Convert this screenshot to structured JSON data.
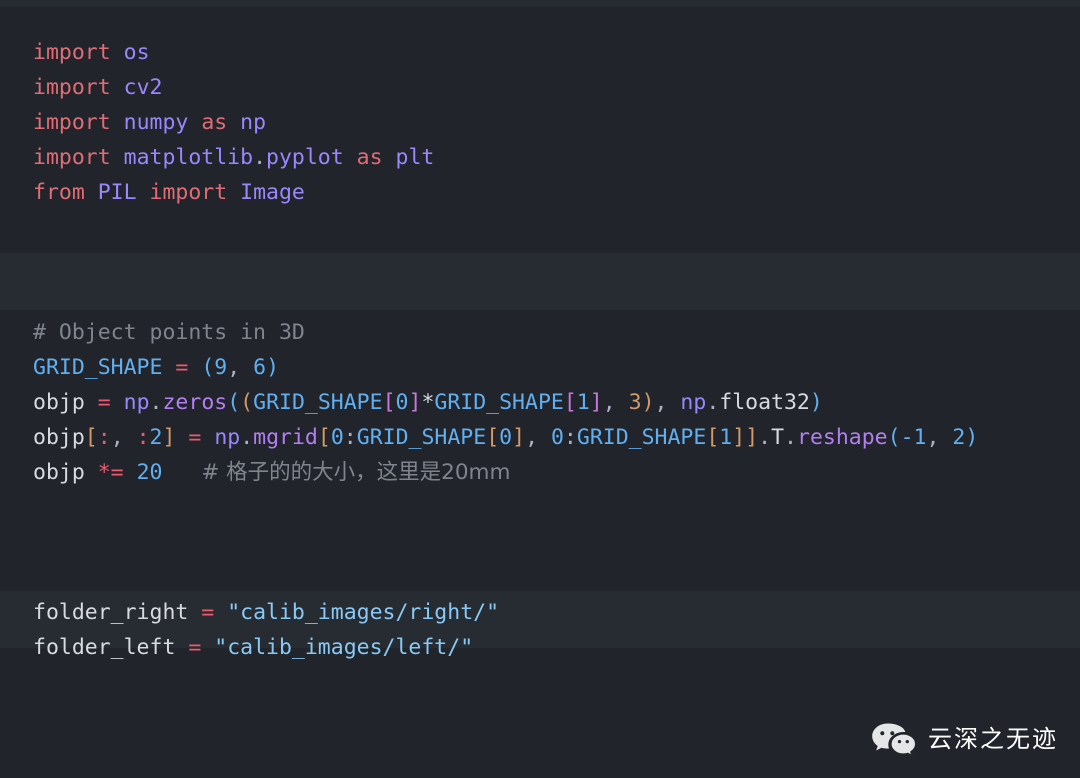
{
  "theme": {
    "background": "#21252b",
    "band_background": "#272c33",
    "foreground": "#d7dae0",
    "keyword_color": "#e06c75",
    "module_color": "#9a86fd",
    "function_color": "#b37ef0",
    "constant_color": "#61afef",
    "number_color": "#61afef",
    "operator_color": "#ef596f",
    "string_color": "#89c9f5",
    "comment_color": "#7f848e",
    "bracket_orange": "#d19a66",
    "bracket_purple": "#c678dd",
    "punctuation_color": "#abb2bf"
  },
  "code": {
    "language": "python",
    "blocks": [
      {
        "id": "imports",
        "lines": [
          "import os",
          "import cv2",
          "import numpy as np",
          "import matplotlib.pyplot as plt",
          "from PIL import Image"
        ]
      },
      {
        "id": "object-points",
        "lines": [
          "# Object points in 3D",
          "GRID_SHAPE = (9, 6)",
          "objp = np.zeros((GRID_SHAPE[0]*GRID_SHAPE[1], 3), np.float32)",
          "objp[:, :2] = np.mgrid[0:GRID_SHAPE[0], 0:GRID_SHAPE[1]].T.reshape(-1, 2)",
          "objp *= 20   # 格子的的大小，这里是20mm"
        ]
      },
      {
        "id": "folders",
        "lines": [
          "folder_right = \"calib_images/right/\"",
          "folder_left = \"calib_images/left/\""
        ]
      }
    ],
    "tokens": {
      "import": "import",
      "from": "from",
      "as": "as",
      "os": "os",
      "cv2": "cv2",
      "numpy": "numpy",
      "np": "np",
      "matplotlib": "matplotlib",
      "pyplot": "pyplot",
      "plt": "plt",
      "PIL": "PIL",
      "Image": "Image",
      "comment_object_points": "# Object points in 3D",
      "grid_shape": "GRID_SHAPE",
      "grid_value_a": "9",
      "grid_value_b": "6",
      "objp": "objp",
      "zeros": "zeros",
      "index_0": "0",
      "index_1": "1",
      "dim_3": "3",
      "float32": "float32",
      "mgrid": "mgrid",
      "transpose": "T",
      "reshape": "reshape",
      "minus_one": "-1",
      "two": "2",
      "scale_value": "20",
      "comment_cell_size": "# 格子的的大小，这里是20mm",
      "folder_right_name": "folder_right",
      "folder_right_value": "\"calib_images/right/\"",
      "folder_left_name": "folder_left",
      "folder_left_value": "\"calib_images/left/\""
    }
  },
  "watermark": {
    "icon": "wechat-logo-icon",
    "text": "云深之无迹"
  }
}
